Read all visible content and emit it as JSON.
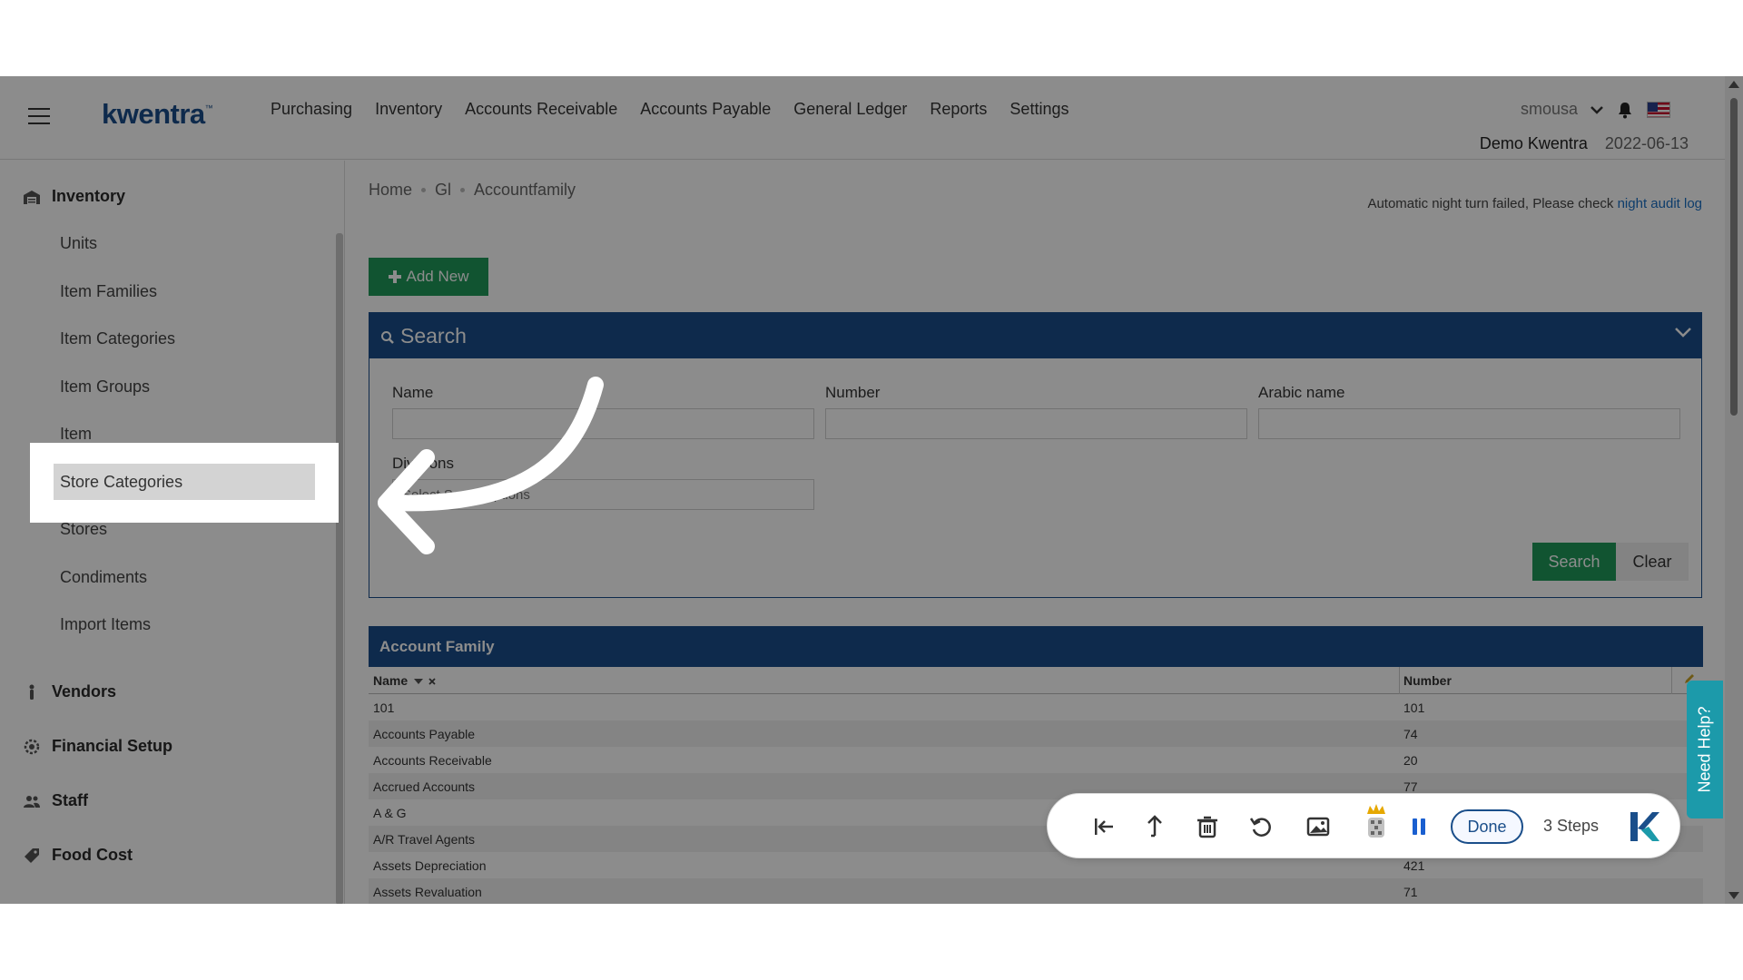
{
  "app": {
    "logo_text": "kwentra",
    "logo_mark": "™"
  },
  "topnav": {
    "items": [
      "Purchasing",
      "Inventory",
      "Accounts Receivable",
      "Accounts Payable",
      "General Ledger",
      "Reports",
      "Settings"
    ]
  },
  "user": {
    "name": "smousa",
    "company": "Demo Kwentra",
    "date": "2022-06-13"
  },
  "sidebar": {
    "section_inventory": "Inventory",
    "items": [
      "Units",
      "Item Families",
      "Item Categories",
      "Item Groups",
      "Item",
      "Store Categories",
      "Stores",
      "Condiments",
      "Import Items"
    ],
    "sections": [
      "Vendors",
      "Financial Setup",
      "Staff",
      "Food Cost"
    ],
    "active_item": "Store Categories"
  },
  "breadcrumb": [
    "Home",
    "Gl",
    "Accountfamily"
  ],
  "notice": {
    "text": "Automatic night turn failed, Please check ",
    "link": "night audit log"
  },
  "actions": {
    "add_new": "Add New"
  },
  "search_panel": {
    "title": "Search",
    "fields": {
      "name_label": "Name",
      "number_label": "Number",
      "arabic_label": "Arabic name",
      "divisions_label": "Divisions",
      "divisions_placeholder": "Select Some Options"
    },
    "search_button": "Search",
    "clear_button": "Clear"
  },
  "grid": {
    "title": "Account Family",
    "columns": [
      "Name",
      "Number"
    ],
    "rows": [
      [
        "101",
        "101"
      ],
      [
        "Accounts Payable",
        "74"
      ],
      [
        "Accounts Receivable",
        "20"
      ],
      [
        "Accrued Accounts",
        "77"
      ],
      [
        "A & G",
        ""
      ],
      [
        "A/R Travel Agents",
        ""
      ],
      [
        "Assets Depreciation",
        "421"
      ],
      [
        "Assets Revaluation",
        "71"
      ]
    ]
  },
  "help_tab": "Need Help?",
  "recorder": {
    "done": "Done",
    "steps": "3 Steps"
  },
  "colors": {
    "brand_blue": "#1a4e8a",
    "success_green": "#1f9a5a",
    "help_teal": "#1c9aaa"
  }
}
